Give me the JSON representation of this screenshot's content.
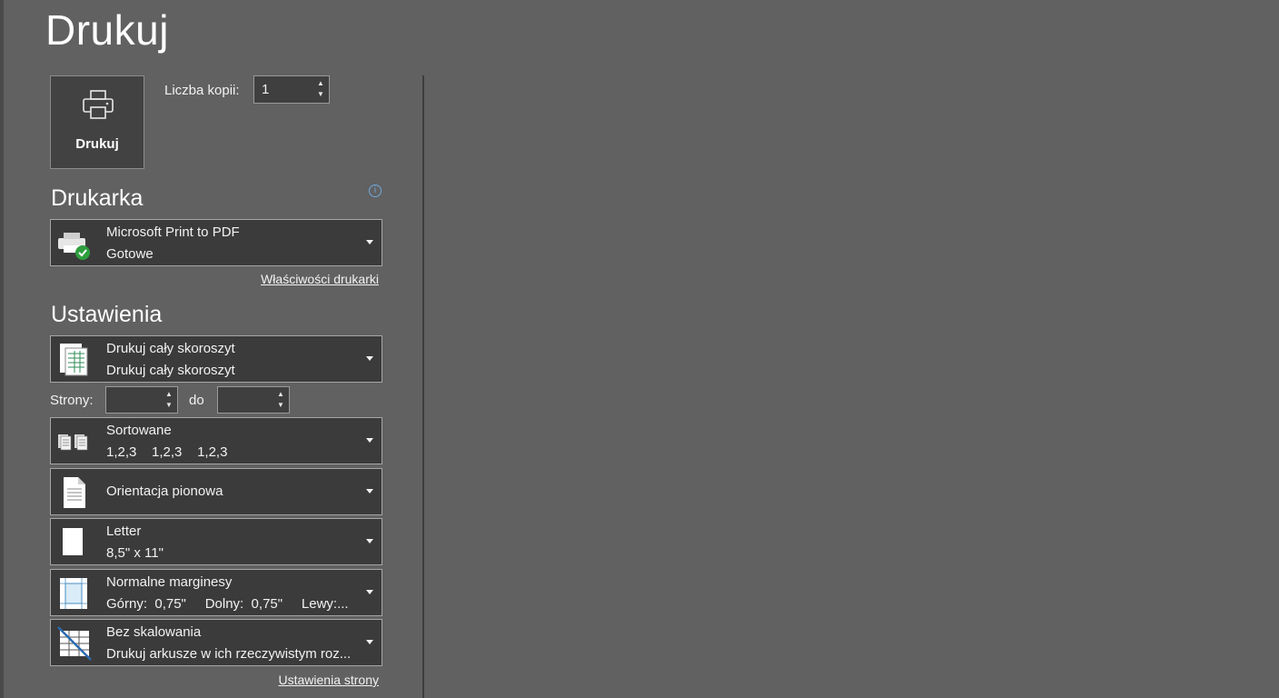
{
  "page": {
    "title": "Drukuj"
  },
  "print_button": {
    "label": "Drukuj",
    "icon": "printer-icon"
  },
  "copies": {
    "label": "Liczba kopii:",
    "value": "1"
  },
  "printer": {
    "heading": "Drukarka",
    "selected_name": "Microsoft Print to PDF",
    "status": "Gotowe",
    "properties_link": "Właściwości drukarki",
    "icon": "printer-ready-icon"
  },
  "settings": {
    "heading": "Ustawienia",
    "scope": {
      "line1": "Drukuj cały skoroszyt",
      "line2": "Drukuj cały skoroszyt",
      "icon": "workbook-icon"
    },
    "pages": {
      "label": "Strony:",
      "from_value": "",
      "to_label": "do",
      "to_value": ""
    },
    "collate": {
      "line1": "Sortowane",
      "line2": "1,2,3    1,2,3    1,2,3",
      "icon": "collated-icon"
    },
    "orientation": {
      "line1": "Orientacja pionowa",
      "icon": "portrait-icon"
    },
    "paper": {
      "line1": "Letter",
      "line2": "8,5\" x 11\"",
      "icon": "paper-icon"
    },
    "margins": {
      "line1": "Normalne marginesy",
      "line2": "Górny:  0,75\"     Dolny:  0,75\"     Lewy:...",
      "icon": "margins-icon"
    },
    "scaling": {
      "line1": "Bez skalowania",
      "line2": "Drukuj arkusze w ich rzeczywistym roz...",
      "icon": "no-scaling-icon"
    },
    "page_setup_link": "Ustawienia strony"
  },
  "colors": {
    "background": "#616161",
    "panel": "#3b3b3b",
    "border": "#a6a6a6",
    "info_blue": "#6fa8dc",
    "check_green": "#2e9e3e"
  }
}
